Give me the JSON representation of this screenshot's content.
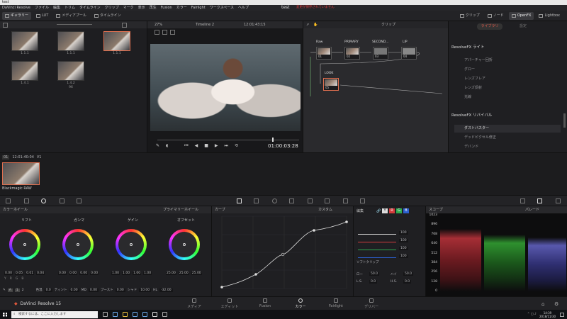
{
  "window": {
    "title": "test"
  },
  "menubar": {
    "items": [
      "DaVinci Resolve",
      "ファイル",
      "編集",
      "トリム",
      "タイムライン",
      "クリップ",
      "マーク",
      "表示",
      "再生",
      "Fusion",
      "カラー",
      "Fairlight",
      "ワークスペース",
      "ヘルプ"
    ],
    "project": "test",
    "unsaved": "変更が保存されていません"
  },
  "toolbar": {
    "left": [
      "ギャラリー",
      "LUT",
      "メディアプール",
      "タイムライン"
    ],
    "right": [
      "クリップ",
      "ノード",
      "OpenFX",
      "Lightbox"
    ]
  },
  "gallery": {
    "stills": [
      {
        "label": "1.1.1"
      },
      {
        "label": "1.1.1"
      },
      {
        "label": "1.1.1"
      },
      {
        "label": "1.4.1"
      },
      {
        "label": "1.4.2"
      }
    ],
    "sub": "96"
  },
  "viewer": {
    "zoom": "27%",
    "timeline": "Timeline 2",
    "timecode_top": "12:01:43:15",
    "timecode": "01:00:03:28"
  },
  "nodes": {
    "header": "クリップ",
    "items": [
      {
        "label": "Raw",
        "num": "01"
      },
      {
        "label": "PRIMARY",
        "num": "02"
      },
      {
        "label": "SECOND...",
        "num": "03"
      },
      {
        "label": "LIP",
        "num": "04"
      },
      {
        "label": "LOOK",
        "num": "05"
      }
    ]
  },
  "fx": {
    "tabs": [
      "ライブラリ",
      "設定"
    ],
    "section1": "ResolveFX ライト",
    "items1": [
      "アパーチャー回折",
      "グロー",
      "レンズフレア",
      "レンズ反射",
      "光線"
    ],
    "section2": "ResolveFX リバイバル",
    "items2": [
      "ダストバスター",
      "デッドピクセル修正",
      "デバンド"
    ]
  },
  "clips": {
    "num": "01",
    "timecode": "12:01:40:04",
    "track": "V1",
    "clip_name": "Blackmagic RAW"
  },
  "wheels": {
    "header": "カラーホイール",
    "mode": "プライマリーホイール",
    "items": [
      {
        "label": "リフト",
        "vals": [
          "0.00",
          "0.05",
          "0.01",
          "0.04"
        ]
      },
      {
        "label": "ガンマ",
        "vals": [
          "0.00",
          "0.00",
          "0.00",
          "0.00"
        ]
      },
      {
        "label": "ゲイン",
        "vals": [
          "1.00",
          "1.00",
          "1.00",
          "1.00"
        ]
      },
      {
        "label": "オフセット",
        "vals": [
          "25.00",
          "25.00",
          "25.00"
        ]
      }
    ],
    "channels": [
      "Y",
      "R",
      "G",
      "B"
    ],
    "footer": {
      "page1": "1",
      "page2": "2",
      "contrast_label": "色温",
      "contrast": "0.0",
      "tint_label": "ティント",
      "tint": "0.00",
      "md_label": "MD",
      "md": "0.00",
      "boost_label": "ブースト",
      "boost": "0.00",
      "shadow_label": "シャド",
      "shadow": "10.00",
      "hl_label": "HL",
      "hl": "-32.00"
    }
  },
  "curves": {
    "header": "カーブ",
    "mode": "カスタム"
  },
  "edit": {
    "header": "編集",
    "channels": [
      "Y",
      "R",
      "G",
      "B"
    ],
    "values": [
      "100",
      "100",
      "100",
      "100"
    ],
    "softclip": "ソフトクリップ",
    "low_label": "ロー",
    "low": "50.0",
    "high_label": "ハイ",
    "high": "50.0",
    "ls_label": "L.S.",
    "ls": "0.0",
    "hs_label": "H.S.",
    "hs": "0.0"
  },
  "scope": {
    "header": "スコープ",
    "mode": "パレード",
    "ticks": [
      "1023",
      "896",
      "768",
      "640",
      "512",
      "384",
      "256",
      "128",
      "0"
    ]
  },
  "app": {
    "name": "DaVinci Resolve 15"
  },
  "pages": [
    {
      "label": "メディア"
    },
    {
      "label": "エディット"
    },
    {
      "label": "Fusion"
    },
    {
      "label": "カラー",
      "active": true
    },
    {
      "label": "Fairlight"
    },
    {
      "label": "デリバー"
    }
  ],
  "taskbar": {
    "search_placeholder": "検索するには、ここに入力します",
    "time": "14:39",
    "date": "2018/11/30"
  },
  "colors": {
    "accent": "#e05a4c",
    "red": "#d43c3c",
    "green": "#2fa84f",
    "blue": "#2b5fcf"
  }
}
